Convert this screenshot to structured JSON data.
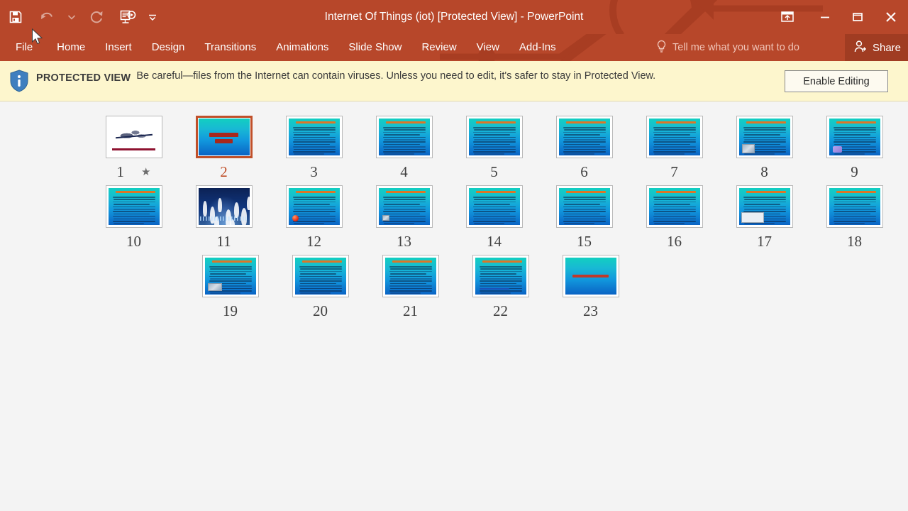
{
  "window": {
    "title": "Internet Of Things (iot) [Protected View] - PowerPoint",
    "accent_color": "#b7472a",
    "share_label": "Share",
    "quick_access": [
      {
        "name": "save-icon",
        "label": "Save",
        "state": "enabled"
      },
      {
        "name": "undo-icon",
        "label": "Undo",
        "state": "disabled"
      },
      {
        "name": "undo-dropdown-icon",
        "label": "Undo options",
        "state": "disabled"
      },
      {
        "name": "redo-icon",
        "label": "Redo",
        "state": "disabled"
      },
      {
        "name": "start-from-beginning-icon",
        "label": "Start From Beginning",
        "state": "enabled"
      },
      {
        "name": "customize-quick-access-toolbar-icon",
        "label": "Customize Quick Access Toolbar",
        "state": "enabled"
      }
    ],
    "controls": [
      {
        "name": "ribbon-display-options-icon",
        "label": "Ribbon Display Options"
      },
      {
        "name": "minimize-icon",
        "label": "Minimize"
      },
      {
        "name": "restore-icon",
        "label": "Restore Down"
      },
      {
        "name": "close-icon",
        "label": "Close"
      }
    ]
  },
  "ribbon": {
    "tabs": [
      {
        "label": "File"
      },
      {
        "label": "Home"
      },
      {
        "label": "Insert"
      },
      {
        "label": "Design"
      },
      {
        "label": "Transitions"
      },
      {
        "label": "Animations"
      },
      {
        "label": "Slide Show"
      },
      {
        "label": "Review"
      },
      {
        "label": "View"
      },
      {
        "label": "Add-Ins"
      }
    ],
    "tell_me_placeholder": "Tell me what you want to do"
  },
  "protected_view": {
    "badge": "PROTECTED VIEW",
    "message": "Be careful—files from the Internet can contain viruses. Unless you need to edit, it's safer to stay in Protected View.",
    "button": "Enable Editing",
    "bar_color": "#fdf6cd"
  },
  "slides": {
    "selected": 2,
    "total": 23,
    "rows": [
      [
        {
          "number": "9",
          "kind": "content",
          "badge": "",
          "extra": "purple"
        },
        {
          "number": "8",
          "kind": "content",
          "badge": "",
          "extra": "photo"
        },
        {
          "number": "7",
          "kind": "content",
          "badge": "",
          "extra": ""
        },
        {
          "number": "6",
          "kind": "content",
          "badge": "",
          "extra": ""
        },
        {
          "number": "5",
          "kind": "content",
          "badge": "",
          "extra": ""
        },
        {
          "number": "4",
          "kind": "content",
          "badge": "",
          "extra": ""
        },
        {
          "number": "3",
          "kind": "content",
          "badge": "",
          "extra": ""
        },
        {
          "number": "2",
          "kind": "title-slide",
          "badge": "",
          "extra": ""
        },
        {
          "number": "1",
          "kind": "bismillah",
          "badge": "★",
          "extra": ""
        }
      ],
      [
        {
          "number": "18",
          "kind": "content",
          "badge": "",
          "extra": ""
        },
        {
          "number": "17",
          "kind": "content",
          "badge": "",
          "extra": "whitebox"
        },
        {
          "number": "16",
          "kind": "content",
          "badge": "",
          "extra": ""
        },
        {
          "number": "15",
          "kind": "content",
          "badge": "",
          "extra": ""
        },
        {
          "number": "14",
          "kind": "content",
          "badge": "",
          "extra": ""
        },
        {
          "number": "13",
          "kind": "content",
          "badge": "",
          "extra": "smallpic"
        },
        {
          "number": "12",
          "kind": "content",
          "badge": "",
          "extra": "redball"
        },
        {
          "number": "11",
          "kind": "people-image",
          "badge": "",
          "extra": ""
        },
        {
          "number": "10",
          "kind": "content",
          "badge": "",
          "extra": ""
        }
      ],
      [
        {
          "number": "23",
          "kind": "thanks",
          "badge": "",
          "extra": ""
        },
        {
          "number": "22",
          "kind": "content",
          "badge": "",
          "extra": "link"
        },
        {
          "number": "21",
          "kind": "content",
          "badge": "",
          "extra": ""
        },
        {
          "number": "20",
          "kind": "content",
          "badge": "",
          "extra": ""
        },
        {
          "number": "19",
          "kind": "content",
          "badge": "",
          "extra": "photo2"
        }
      ]
    ]
  }
}
